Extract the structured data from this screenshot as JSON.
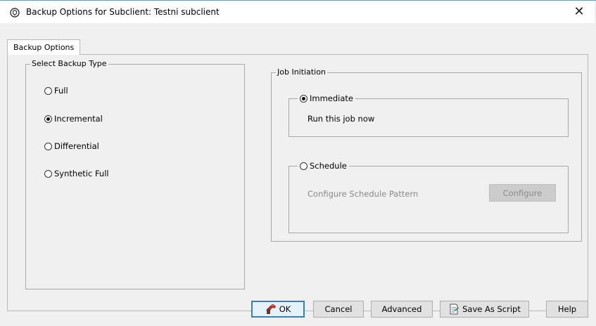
{
  "window": {
    "title": "Backup Options for Subclient: Testni subclient",
    "icon": "commvault-shield-icon",
    "close_label": "✕"
  },
  "tabs": [
    {
      "label": "Backup Options",
      "selected": true
    }
  ],
  "backup_type": {
    "legend": "Select Backup Type",
    "options": [
      {
        "label": "Full",
        "checked": false
      },
      {
        "label": "Incremental",
        "checked": true
      },
      {
        "label": "Differential",
        "checked": false
      },
      {
        "label": "Synthetic Full",
        "checked": false
      }
    ]
  },
  "job_initiation": {
    "legend": "Job Initiation",
    "immediate": {
      "label": "Immediate",
      "checked": true,
      "description": "Run this job now"
    },
    "schedule": {
      "label": "Schedule",
      "checked": false,
      "description": "Configure Schedule Pattern",
      "configure_label": "Configure"
    }
  },
  "buttons": {
    "ok": "OK",
    "cancel": "Cancel",
    "advanced": "Advanced",
    "save_as_script": "Save As Script",
    "help": "Help"
  },
  "colors": {
    "window_border": "#5b9bd5",
    "default_button_border": "#3c7fb1",
    "disabled_text": "#8a8a8a"
  }
}
